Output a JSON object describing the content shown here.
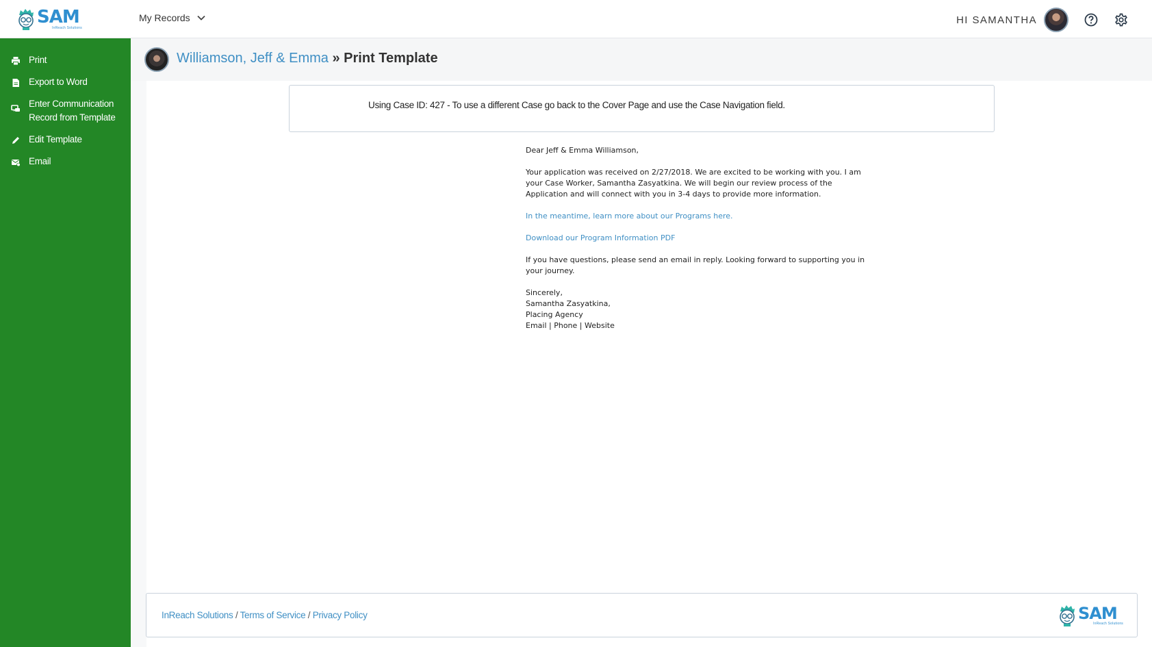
{
  "app": {
    "logo_text": "SAM",
    "logo_sub": "InReach Solutions"
  },
  "topbar": {
    "records_menu": "My Records",
    "greeting": "HI SAMANTHA"
  },
  "sidebar": {
    "items": [
      {
        "label": "Print",
        "icon": "printer-icon"
      },
      {
        "label": "Export to Word",
        "icon": "document-icon"
      },
      {
        "label": "Enter Communication Record from Template",
        "icon": "chat-icon"
      },
      {
        "label": "Edit Template",
        "icon": "pencil-icon"
      },
      {
        "label": "Email",
        "icon": "email-icon"
      }
    ]
  },
  "header": {
    "record_name": "Williamson, Jeff & Emma",
    "separator": "»",
    "section": "Print Template"
  },
  "notice": {
    "text": "Using Case ID: 427 - To use a different Case go back to the Cover Page and use the Case Navigation field."
  },
  "letter": {
    "greeting": "Dear Jeff & Emma Williamson,",
    "body1": "Your application was received on 2/27/2018.  We are excited to be working with you. I am your Case Worker, Samantha Zasyatkina. We will begin our review process of the Application and will connect with you in 3-4 days to provide more information.",
    "link1": "In the meantime, learn more about our Programs here.",
    "link2": "Download our Program Information PDF",
    "body2": "If you have questions, please send an email in reply. Looking forward to supporting you in your journey.",
    "closing": "Sincerely,",
    "signer": "Samantha Zasyatkina,",
    "agency": "Placing Agency",
    "contacts": "Email | Phone | Website"
  },
  "footer": {
    "links": [
      "InReach Solutions",
      "Terms of Service",
      "Privacy Policy"
    ],
    "separator": "/"
  },
  "colors": {
    "sidebar_bg": "#238726",
    "link": "#3f8fc4",
    "brand": "#2f8fd0"
  }
}
